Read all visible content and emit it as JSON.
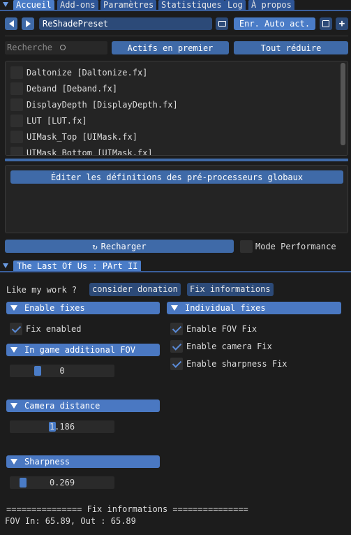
{
  "tabs": [
    "Accueil",
    "Add-ons",
    "Paramètres",
    "Statistiques",
    "Log",
    "À propos"
  ],
  "toolbar": {
    "preset_name": "ReShadePreset",
    "auto_save_label": "Enr. Auto act."
  },
  "search": {
    "placeholder": "Recherche",
    "active_first_label": "Actifs en premier",
    "collapse_all_label": "Tout réduire"
  },
  "effects": [
    "Daltonize [Daltonize.fx]",
    "Deband [Deband.fx]",
    "DisplayDepth [DisplayDepth.fx]",
    "LUT [LUT.fx]",
    "UIMask_Top [UIMask.fx]",
    "UIMask_Bottom [UIMask.fx]"
  ],
  "preprocessor_button": "Éditer les définitions des pré-processeurs globaux",
  "reload_label": "Recharger",
  "performance_mode_label": "Mode Performance",
  "addon": {
    "title": "The Last Of Us : PArt II",
    "like_text": "Like my work ?",
    "donation_label": "consider donation",
    "fix_info_button": "Fix informations",
    "enable_fixes_header": "Enable fixes",
    "fix_enabled_label": "Fix enabled",
    "individual_fixes_header": "Individual fixes",
    "individual_fixes": [
      "Enable FOV Fix",
      "Enable camera Fix",
      "Enable sharpness Fix"
    ],
    "fov_header": "In game additional FOV",
    "fov_value": "0",
    "fov_fraction": 0.25,
    "camera_header": "Camera distance",
    "camera_value": "1.186",
    "camera_fraction": 0.4,
    "sharpness_header": "Sharpness",
    "sharpness_value": "0.269",
    "sharpness_fraction": 0.1,
    "info_separator": "=============== Fix informations ===============",
    "fov_info": "FOV In: 65.89, Out : 65.89"
  }
}
